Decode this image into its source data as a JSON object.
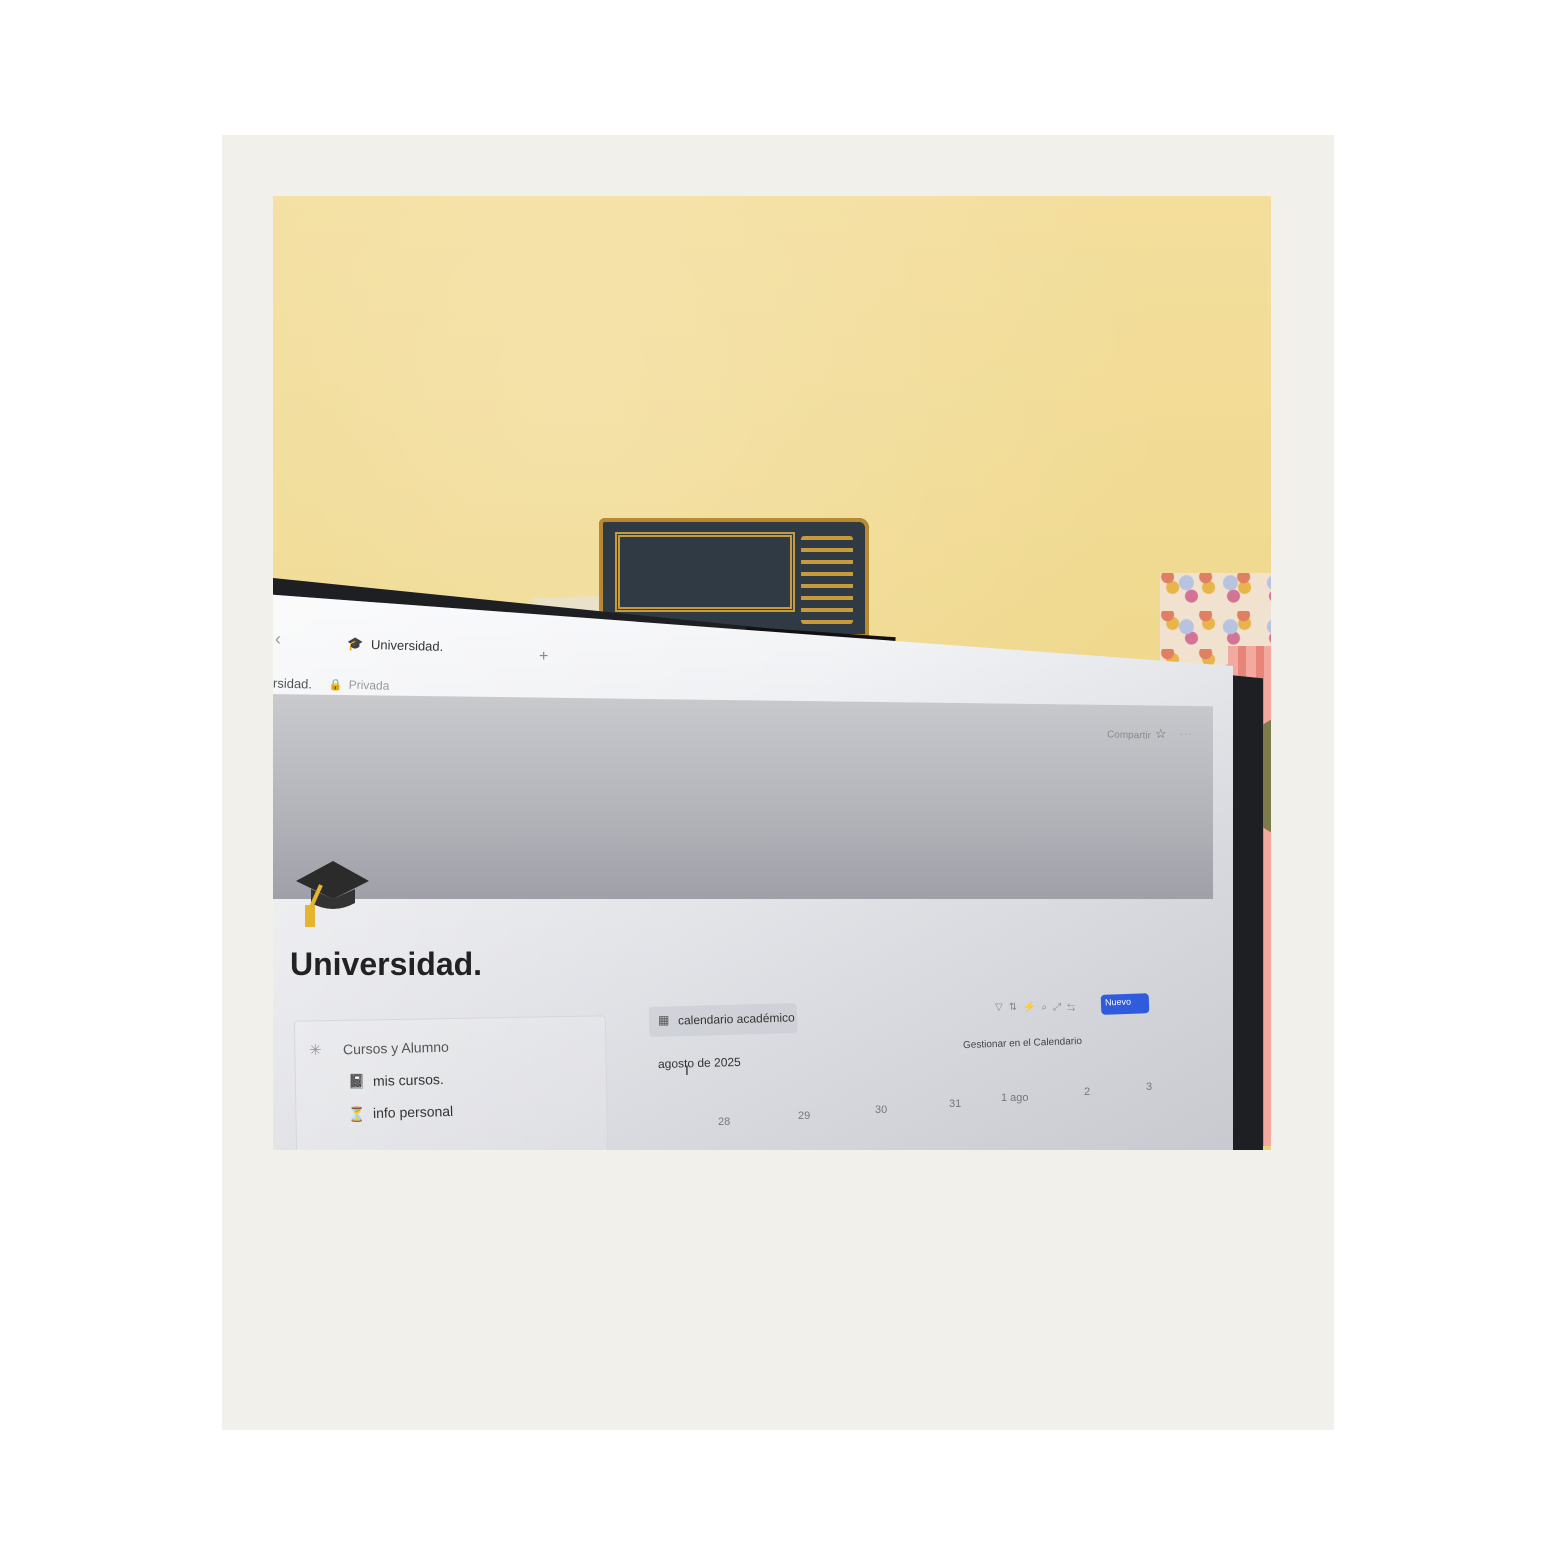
{
  "tab": {
    "title": "Universidad."
  },
  "breadcrumb": {
    "page": "rsidad.",
    "privacy": "Privada"
  },
  "topbar": {
    "share": "Compartir"
  },
  "page": {
    "title": "Universidad."
  },
  "callout": {
    "heading": "Cursos y Alumno",
    "items": [
      {
        "label": "mis cursos.",
        "icon": "notebook-icon"
      },
      {
        "label": "info personal",
        "icon": "hourglass-icon"
      }
    ]
  },
  "calendar": {
    "view_label": "calendario académico",
    "month": "agosto de 2025",
    "new_button": "Nuevo",
    "manage_label": "Gestionar en el Calendario",
    "days": [
      "28",
      "29",
      "30",
      "31",
      "1 ago",
      "2",
      "3"
    ]
  }
}
